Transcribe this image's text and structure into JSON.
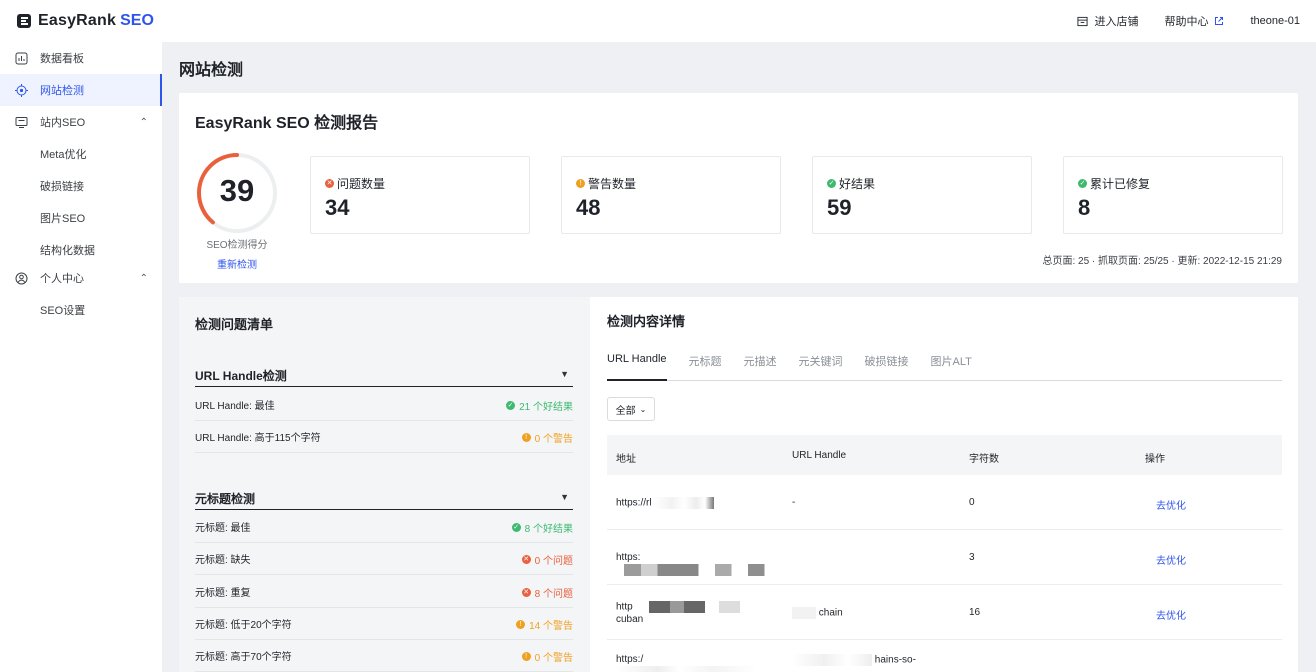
{
  "header": {
    "brand_name": "EasyRank",
    "brand_suffix": "SEO",
    "enter_store": "进入店铺",
    "help_center": "帮助中心",
    "account": "theone-01"
  },
  "sidebar": {
    "items": [
      {
        "label": "数据看板",
        "icon": "dashboard-icon"
      },
      {
        "label": "网站检测",
        "icon": "target-icon",
        "active": true
      },
      {
        "label": "站内SEO",
        "icon": "monitor-icon",
        "expanded": true
      },
      {
        "label": "Meta优化"
      },
      {
        "label": "破损链接"
      },
      {
        "label": "图片SEO"
      },
      {
        "label": "结构化数据"
      },
      {
        "label": "个人中心",
        "icon": "user-circle-icon",
        "expanded": true
      },
      {
        "label": "SEO设置"
      }
    ]
  },
  "page": {
    "title": "网站检测"
  },
  "report": {
    "title": "EasyRank SEO 检测报告",
    "score": "39",
    "score_fraction": 0.39,
    "score_label": "SEO检测得分",
    "rescan": "重新检测",
    "stats": [
      {
        "label": "问题数量",
        "value": "34",
        "status": "red"
      },
      {
        "label": "警告数量",
        "value": "48",
        "status": "orange"
      },
      {
        "label": "好结果",
        "value": "59",
        "status": "green"
      },
      {
        "label": "累计已修复",
        "value": "8",
        "status": "green"
      }
    ],
    "meta": "总页面: 25 · 抓取页面: 25/25 · 更新: 2022-12-15 21:29"
  },
  "issues": {
    "title": "检测问题清单",
    "groups": [
      {
        "title": "URL Handle检测",
        "rows": [
          {
            "label": "URL Handle: 最佳",
            "result": "21 个好结果",
            "status": "green"
          },
          {
            "label": "URL Handle: 高于115个字符",
            "result": "0 个警告",
            "status": "orange"
          }
        ]
      },
      {
        "title": "元标题检测",
        "rows": [
          {
            "label": "元标题: 最佳",
            "result": "8 个好结果",
            "status": "green"
          },
          {
            "label": "元标题: 缺失",
            "result": "0 个问题",
            "status": "red"
          },
          {
            "label": "元标题: 重复",
            "result": "8 个问题",
            "status": "red"
          },
          {
            "label": "元标题: 低于20个字符",
            "result": "14 个警告",
            "status": "orange"
          },
          {
            "label": "元标题: 高于70个字符",
            "result": "0 个警告",
            "status": "orange"
          }
        ]
      }
    ]
  },
  "details": {
    "title": "检测内容详情",
    "tabs": [
      "URL Handle",
      "元标题",
      "元描述",
      "元关键词",
      "破损链接",
      "图片ALT"
    ],
    "filter": "全部",
    "columns": [
      "地址",
      "URL Handle",
      "字符数",
      "操作"
    ],
    "rows": [
      {
        "url": "https://rl",
        "handle": "-",
        "count": "0",
        "action": "去优化"
      },
      {
        "url": "https:",
        "handle": "",
        "count": "3",
        "action": "去优化"
      },
      {
        "url": "http",
        "url2": "cuban",
        "handle": "chain",
        "count": "16",
        "action": "去优化"
      },
      {
        "url": "https:/",
        "handle": "hains-so-",
        "count": "",
        "action": ""
      }
    ]
  }
}
